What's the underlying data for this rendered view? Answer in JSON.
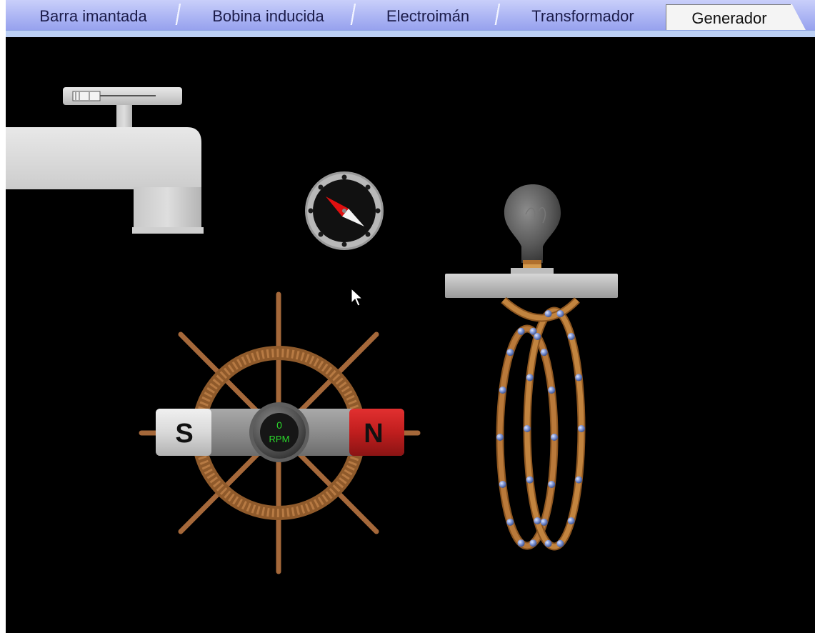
{
  "tabs": [
    {
      "label": "Barra imantada",
      "active": false
    },
    {
      "label": "Bobina inducida",
      "active": false
    },
    {
      "label": "Electroimán",
      "active": false
    },
    {
      "label": "Transformador",
      "active": false
    },
    {
      "label": "Generador",
      "active": true
    }
  ],
  "magnet": {
    "south_label": "S",
    "north_label": "N"
  },
  "tachometer": {
    "value": "0",
    "unit": "RPM"
  },
  "faucet": {
    "flow_level": 0.15
  },
  "colors": {
    "tab_strip": "#aab3f3",
    "background": "#000000",
    "magnet_north": "#c3201f",
    "magnet_south": "#d8d8d8",
    "wood": "#a0642d",
    "coil": "#b0702e",
    "rpm_text": "#2bd82b",
    "compass_needle_north": "#e01010"
  },
  "icons": [
    "faucet-icon",
    "compass-icon",
    "light-bulb-icon",
    "ship-wheel-icon",
    "bar-magnet-icon",
    "coil-icon",
    "cursor-arrow-icon"
  ]
}
